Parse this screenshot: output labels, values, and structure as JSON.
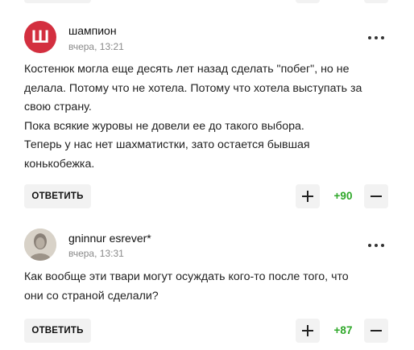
{
  "comments": [
    {
      "avatar_letter": "Ш",
      "author": "шампион",
      "date": "вчера, 13:21",
      "lines": [
        "Костенюк могла еще десять лет назад сделать \"побег\", но не",
        "делала. Потому что не хотела. Потому что хотела выступать за",
        "свою страну.",
        "Пока всякие журовы не довели ее до такого выбора.",
        "Теперь у нас нет шахматистки, зато остается бывшая",
        "конькобежка."
      ],
      "reply_label": "ОТВЕТИТЬ",
      "score": "+90"
    },
    {
      "author": "gninnur esrever*",
      "date": "вчера, 13:31",
      "lines": [
        "Как вообще эти твари могут осуждать кого-то после того, что",
        "они со страной сделали?"
      ],
      "reply_label": "ОТВЕТИТЬ",
      "score": "+87"
    }
  ],
  "colors": {
    "avatar_red": "#d32f3f",
    "score_green": "#2fa82a",
    "button_bg": "#f2f2f2"
  },
  "icons": {
    "menu": "more-dots-icon",
    "plus": "plus-icon",
    "minus": "minus-icon"
  }
}
